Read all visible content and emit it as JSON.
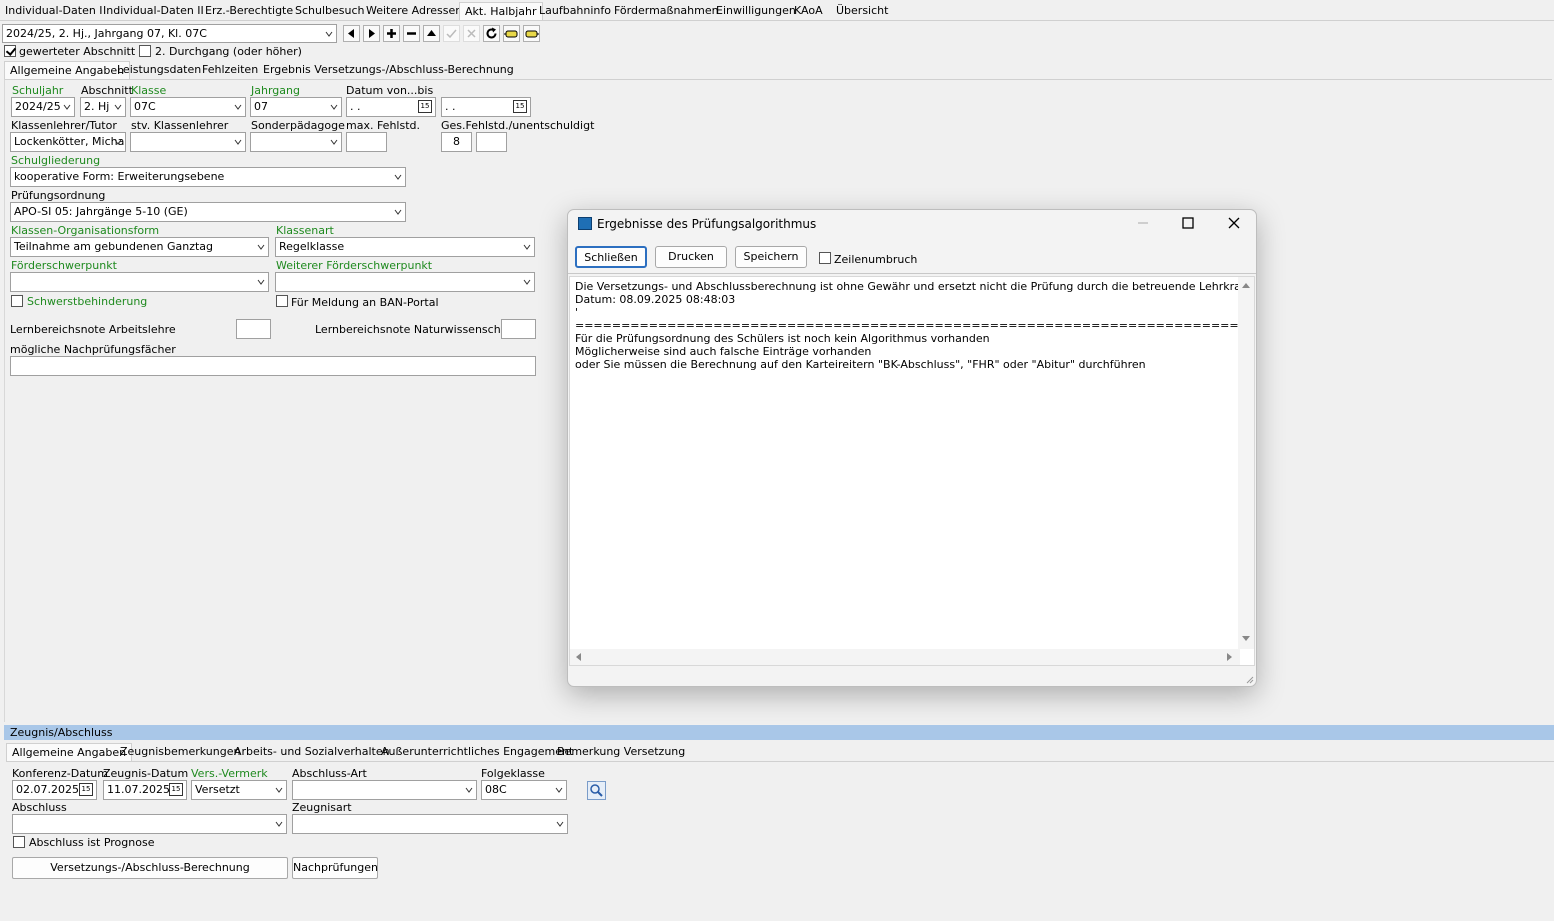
{
  "top_tabs": [
    "Individual-Daten I",
    "Individual-Daten II",
    "Erz.-Berechtigte",
    "Schulbesuch",
    "Weitere Adressen",
    "Akt. Halbjahr",
    "Laufbahninfo",
    "Fördermaßnahmen",
    "Einwilligungen",
    "KAoA",
    "Übersicht"
  ],
  "toolbar": {
    "period_select": "2024/25, 2. Hj., Jahrgang 07, Kl. 07C"
  },
  "flags": {
    "gewerteter": "gewerteter Abschnitt",
    "durchgang": "2. Durchgang (oder höher)"
  },
  "sub_tabs": [
    "Allgemeine Angaben",
    "Leistungsdaten",
    "Fehlzeiten",
    "Ergebnis Versetzungs-/Abschluss-Berechnung"
  ],
  "form": {
    "schuljahr_label": "Schuljahr",
    "schuljahr": "2024/25",
    "abschnitt_label": "Abschnitt",
    "abschnitt": "2. Hj",
    "klasse_label": "Klasse",
    "klasse": "07C",
    "jahrgang_label": "Jahrgang",
    "jahrgang": "07",
    "datum_label": "Datum von...bis",
    "datum_von": " .  .",
    "datum_bis": " .  .",
    "klassenlehrer_label": "Klassenlehrer/Tutor",
    "klassenlehrer": "Lockenkötter, Micha",
    "stv_label": "stv. Klassenlehrer",
    "sonder_label": "Sonderpädagoge",
    "maxfehl_label": "max. Fehlstd.",
    "gesfehl_label": "Ges.Fehlstd./unentschuldigt",
    "gesfehl": "8",
    "schulgliederung_label": "Schulgliederung",
    "schulgliederung": "kooperative Form: Erweiterungsebene",
    "pruefung_label": "Prüfungsordnung",
    "pruefung": "APO-SI 05: Jahrgänge 5-10 (GE)",
    "org_label": "Klassen-Organisationsform",
    "org": "Teilnahme am gebundenen Ganztag",
    "klassenart_label": "Klassenart",
    "klassenart": "Regelklasse",
    "foerder_label": "Förderschwerpunkt",
    "foerder2_label": "Weiterer Förderschwerpunkt",
    "schwerst_label": "Schwerstbehinderung",
    "ban_label": "Für Meldung an BAN-Portal",
    "arbeitslehre_label": "Lernbereichsnote Arbeitslehre",
    "natur_label": "Lernbereichsnote Naturwissenschaft",
    "nachpruef_label": "mögliche Nachprüfungsfächer"
  },
  "dialog": {
    "title": "Ergebnisse des Prüfungsalgorithmus",
    "close_btn": "Schließen",
    "print_btn": "Drucken",
    "save_btn": "Speichern",
    "wrap_label": "Zeilenumbruch",
    "text": "Die Versetzungs- und Abschlussberechnung ist ohne Gewähr und ersetzt nicht die Prüfung durch die betreuende Lehrkraft.\nDatum: 08.09.2025 08:48:03\n'\n=========================================================================\nFür die Prüfungsordnung des Schülers ist noch kein Algorithmus vorhanden\nMöglicherweise sind auch falsche Einträge vorhanden\noder Sie müssen die Berechnung auf den Karteireitern \"BK-Abschluss\", \"FHR\" oder \"Abitur\" durchführen"
  },
  "zeugnis": {
    "header": "Zeugnis/Abschluss",
    "tabs": [
      "Allgemeine Angaben",
      "Zeugnisbemerkungen",
      "Arbeits- und Sozialverhalten",
      "Außerunterrichtliches Engagement",
      "Bemerkung Versetzung"
    ],
    "konferenz_label": "Konferenz-Datum",
    "konferenz": "02.07.2025",
    "zeugnis_label": "Zeugnis-Datum",
    "zeugnisdatum": "11.07.2025",
    "vers_label_green": "Vers.",
    "vers_label_rest": "-Vermerk",
    "vers": "Versetzt",
    "abschlussart_label": "Abschluss-Art",
    "folge_label": "Folgeklasse",
    "folge": "08C",
    "abschluss_label": "Abschluss",
    "zeugnisart_label": "Zeugnisart",
    "prognose_label": "Abschluss ist Prognose",
    "calc_btn": "Versetzungs-/Abschluss-Berechnung",
    "nach_btn": "Nachprüfungen"
  },
  "colors": {
    "green_label": "#1f8a1f",
    "section_header": "#a9c7e8"
  }
}
